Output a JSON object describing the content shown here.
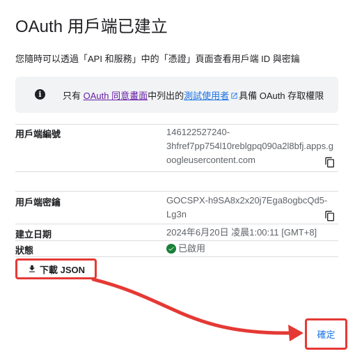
{
  "dialog": {
    "title": "OAuth 用戶端已建立",
    "description": "您隨時可以透過「API 和服務」中的「憑證」頁面查看用戶端 ID 與密鑰",
    "info": {
      "prefix": "只有 ",
      "consent_link": "OAuth 同意畫面",
      "middle": "中列出的",
      "test_users_link": "測試使用者",
      "suffix": "具備 OAuth 存取權限",
      "icon": "info-icon"
    },
    "fields": {
      "client_id_label": "用戶端編號",
      "client_id_line1": "146122527240-",
      "client_id_line2": "3hfref7pp754l10reblgpq090a2l8bfj.apps.g",
      "client_id_line3": "oogleusercontent.com",
      "client_secret_label": "用戶端密鑰",
      "client_secret_line1": "GOCSPX-h9SA8x2x20j7Ega8ogbcQd5-",
      "client_secret_line2": "Lg3n",
      "created_label": "建立日期",
      "created_value": "2024年6月20日 凌晨1:00:11 [GMT+8]",
      "status_label": "狀態",
      "status_value": "已啟用"
    },
    "download_button": "下載 JSON",
    "ok_button": "確定"
  },
  "colors": {
    "annotation_red": "#e53935",
    "link_purple": "#681da8",
    "link_blue": "#1a73e8",
    "status_green": "#188038"
  }
}
